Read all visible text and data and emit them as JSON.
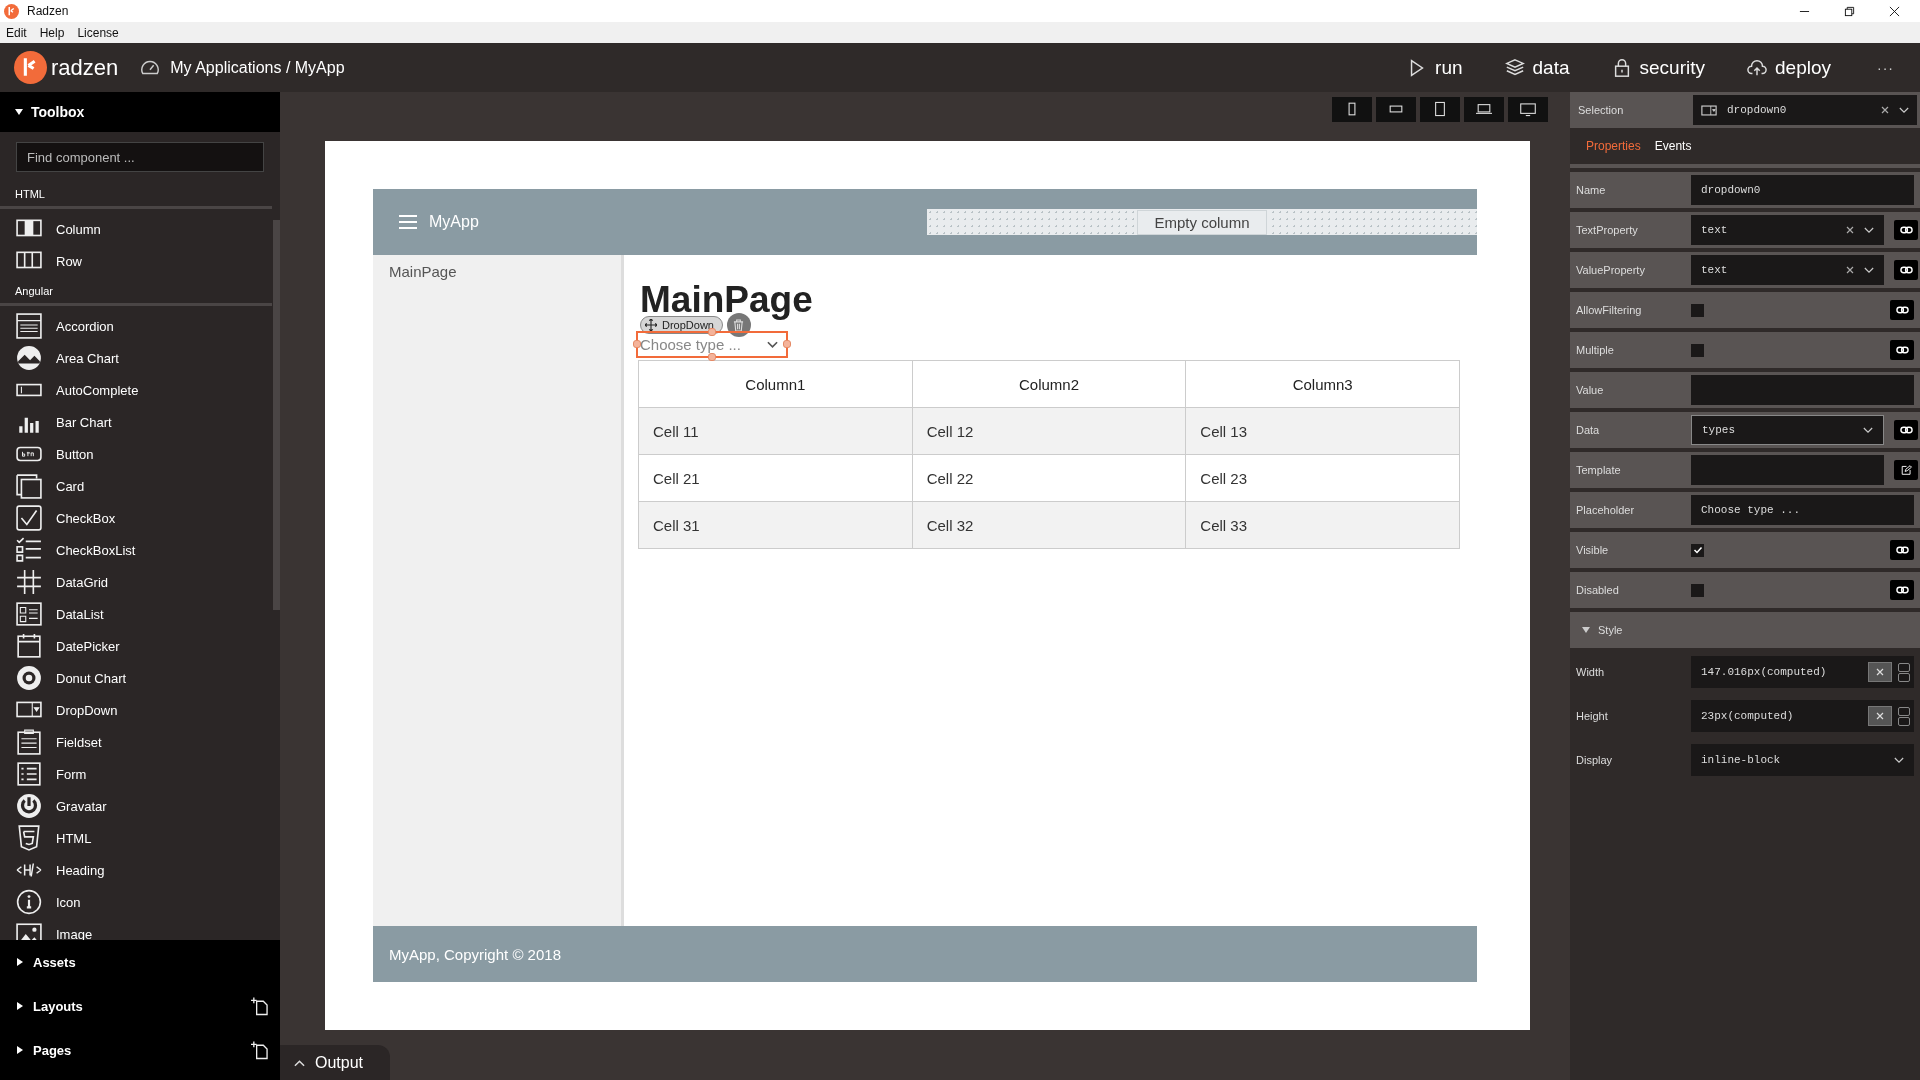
{
  "window": {
    "title": "Radzen"
  },
  "menu": [
    "Edit",
    "Help",
    "License"
  ],
  "header": {
    "logo": "radzen",
    "breadcrumb": "My Applications / MyApp",
    "actions": [
      {
        "kind": "run",
        "label": "run"
      },
      {
        "kind": "data",
        "label": "data"
      },
      {
        "kind": "security",
        "label": "security"
      },
      {
        "kind": "deploy",
        "label": "deploy"
      }
    ],
    "more": "···"
  },
  "toolbox": {
    "title": "Toolbox",
    "expanded": true,
    "search": {
      "placeholder": "Find component ..."
    },
    "sections": [
      {
        "title": "HTML",
        "items": [
          {
            "label": "Column"
          },
          {
            "label": "Row"
          }
        ]
      },
      {
        "title": "Angular",
        "items": [
          {
            "label": "Accordion"
          },
          {
            "label": "Area Chart"
          },
          {
            "label": "AutoComplete"
          },
          {
            "label": "Bar Chart"
          },
          {
            "label": "Button"
          },
          {
            "label": "Card"
          },
          {
            "label": "CheckBox"
          },
          {
            "label": "CheckBoxList"
          },
          {
            "label": "DataGrid"
          },
          {
            "label": "DataList"
          },
          {
            "label": "DatePicker"
          },
          {
            "label": "Donut Chart"
          },
          {
            "label": "DropDown"
          },
          {
            "label": "Fieldset"
          },
          {
            "label": "Form"
          },
          {
            "label": "Gravatar"
          },
          {
            "label": "HTML"
          },
          {
            "label": "Heading"
          },
          {
            "label": "Icon"
          },
          {
            "label": "Image"
          }
        ]
      }
    ]
  },
  "panels": [
    {
      "label": "Assets",
      "addable": false
    },
    {
      "label": "Layouts",
      "addable": true
    },
    {
      "label": "Pages",
      "addable": true
    }
  ],
  "output": {
    "label": "Output"
  },
  "canvas": {
    "app_title": "MyApp",
    "empty_column": "Empty column",
    "nav_items": [
      "MainPage"
    ],
    "heading": "MainPage",
    "selection_badge": "DropDown",
    "dropdown": {
      "placeholder": "Choose type ..."
    },
    "table": {
      "columns": [
        "Column1",
        "Column2",
        "Column3"
      ],
      "rows": [
        [
          "Cell 11",
          "Cell 12",
          "Cell 13"
        ],
        [
          "Cell 21",
          "Cell 22",
          "Cell 23"
        ],
        [
          "Cell 31",
          "Cell 32",
          "Cell 33"
        ]
      ]
    },
    "footer": "MyApp, Copyright © 2018"
  },
  "properties": {
    "selection_label": "Selection",
    "selection": "dropdown0",
    "tabs": [
      {
        "label": "Properties",
        "selected": true
      },
      {
        "label": "Events",
        "selected": false
      }
    ],
    "rows": [
      {
        "label": "Name",
        "kind": "input",
        "value": "dropdown0",
        "bindable": false
      },
      {
        "label": "TextProperty",
        "kind": "select",
        "value": "text",
        "clearable": true,
        "bindable": true
      },
      {
        "label": "ValueProperty",
        "kind": "select",
        "value": "text",
        "clearable": true,
        "bindable": true
      },
      {
        "label": "AllowFiltering",
        "kind": "checkbox",
        "checked": false,
        "bindable": true
      },
      {
        "label": "Multiple",
        "kind": "checkbox",
        "checked": false,
        "bindable": true
      },
      {
        "label": "Value",
        "kind": "input",
        "bindable": false
      },
      {
        "label": "Data",
        "kind": "select",
        "value": "types",
        "clearable": false,
        "bindable": true
      },
      {
        "label": "Template",
        "kind": "template"
      },
      {
        "label": "Placeholder",
        "kind": "input",
        "value": "Choose type ...",
        "bindable": false
      },
      {
        "label": "Visible",
        "kind": "checkbox",
        "checked": true,
        "bindable": true
      },
      {
        "label": "Disabled",
        "kind": "checkbox",
        "checked": false,
        "bindable": true
      }
    ],
    "style": {
      "title": "Style",
      "expanded": true,
      "rows": [
        {
          "label": "Width",
          "kind": "computed",
          "value": "147.016px(computed)"
        },
        {
          "label": "Height",
          "kind": "computed",
          "value": "23px(computed)"
        },
        {
          "label": "Display",
          "kind": "select",
          "value": "inline-block"
        }
      ]
    }
  }
}
